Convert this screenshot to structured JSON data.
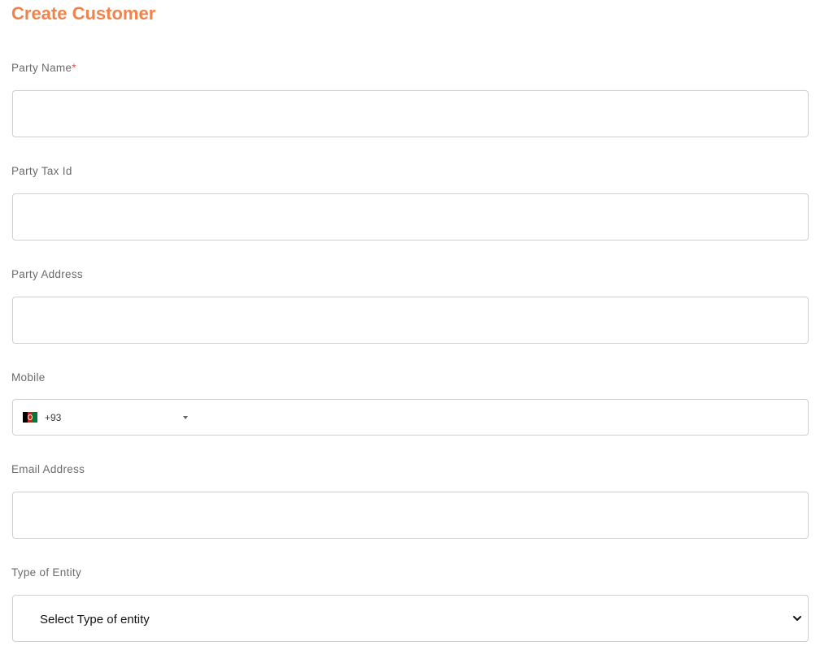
{
  "page": {
    "title": "Create Customer"
  },
  "form": {
    "party_name": {
      "label": "Party Name",
      "required_mark": "*",
      "value": ""
    },
    "party_tax_id": {
      "label": "Party Tax Id",
      "value": ""
    },
    "party_address": {
      "label": "Party Address",
      "value": ""
    },
    "mobile": {
      "label": "Mobile",
      "country_flag": "afghanistan-flag-icon",
      "dial_code": "+93",
      "value": ""
    },
    "email": {
      "label": "Email Address",
      "value": ""
    },
    "entity_type": {
      "label": "Type of Entity",
      "selected": "Select Type of entity"
    }
  },
  "colors": {
    "accent": "#f0834a",
    "label": "#6b6b6b",
    "border": "#cfcfcf",
    "required": "#e0554f",
    "flag_black": "#000000",
    "flag_red": "#d32011",
    "flag_green": "#007a36"
  }
}
